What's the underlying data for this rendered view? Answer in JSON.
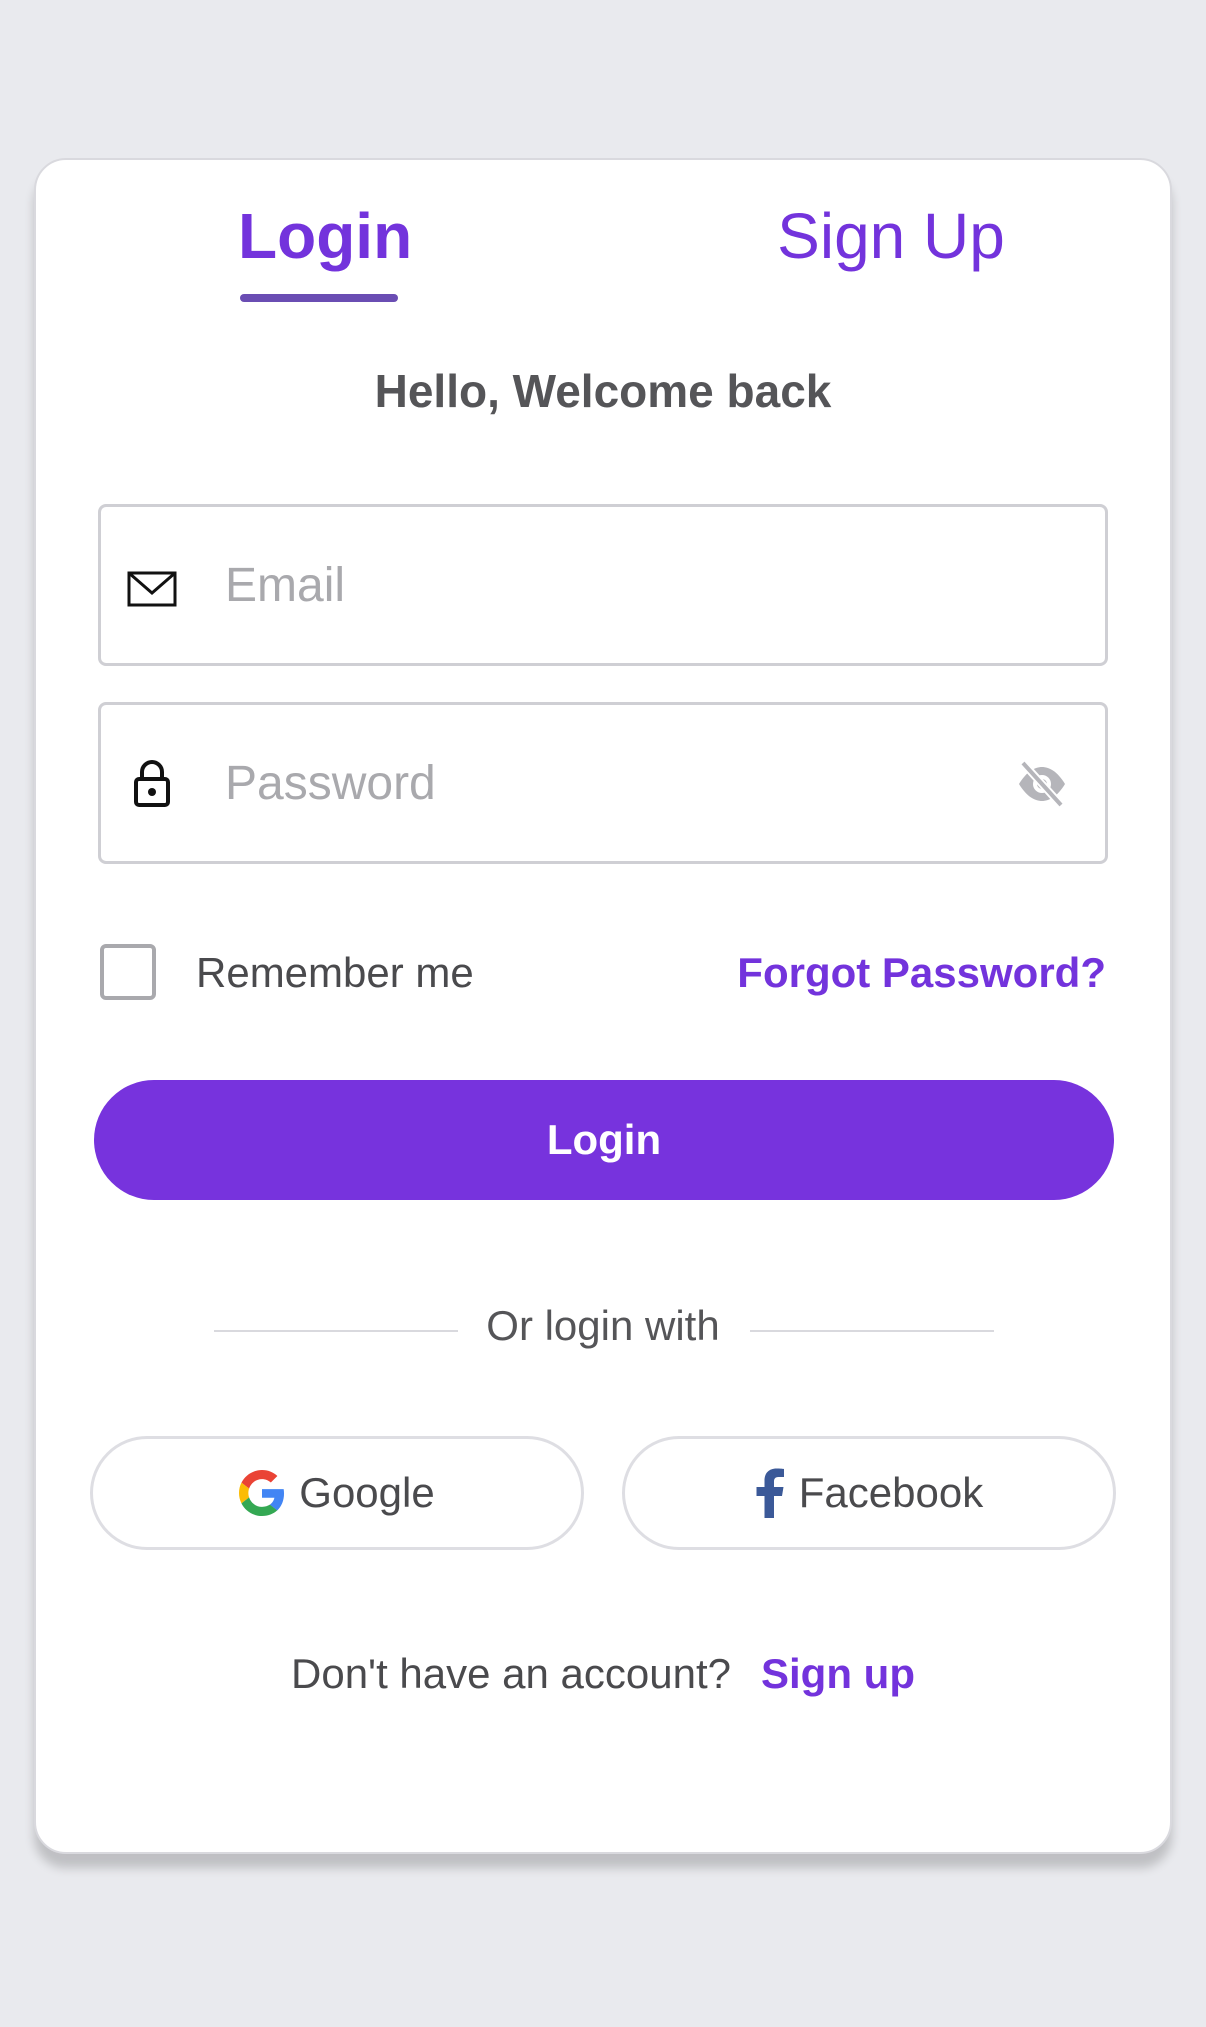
{
  "tabs": {
    "login": "Login",
    "signup": "Sign Up"
  },
  "welcome": "Hello, Welcome back",
  "form": {
    "email_placeholder": "Email",
    "password_placeholder": "Password",
    "remember_label": "Remember me",
    "forgot_label": "Forgot Password?",
    "login_button": "Login"
  },
  "divider_text": "Or login with",
  "social": {
    "google": "Google",
    "facebook": "Facebook"
  },
  "footer": {
    "prompt": "Don't have an account?",
    "signup_link": "Sign up"
  },
  "colors": {
    "accent": "#7733dd",
    "background": "#e9eaee"
  },
  "icons": {
    "email": "mail-icon",
    "password": "lock-icon",
    "visibility": "eye-off-icon",
    "google": "google-icon",
    "facebook": "facebook-icon"
  }
}
